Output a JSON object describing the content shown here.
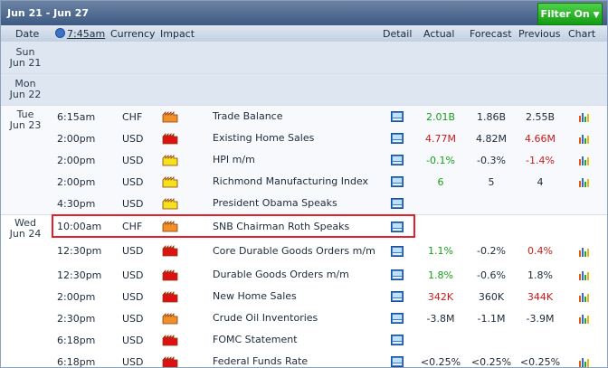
{
  "header": {
    "date_range": "Jun 21 - Jun 27",
    "filter_label": "Filter On"
  },
  "columns": {
    "date": "Date",
    "time": "7:45am",
    "currency": "Currency",
    "impact": "Impact",
    "detail": "Detail",
    "actual": "Actual",
    "forecast": "Forecast",
    "previous": "Previous",
    "chart": "Chart"
  },
  "days": {
    "sun": {
      "name": "Sun",
      "date": "Jun 21"
    },
    "mon": {
      "name": "Mon",
      "date": "Jun 22"
    },
    "tue": {
      "name": "Tue",
      "date": "Jun 23"
    },
    "wed": {
      "name": "Wed",
      "date": "Jun 24"
    }
  },
  "impact_colors": {
    "high": "#dd1111",
    "medium": "#f0902a",
    "low": "#f5e21a",
    "holiday": "#d94f1e"
  },
  "events": [
    {
      "time": "6:15am",
      "currency": "CHF",
      "impact": "medium",
      "event": "Trade Balance",
      "actual": "2.01B",
      "actual_color": "green",
      "forecast": "1.86B",
      "previous": "2.55B",
      "previous_color": "dark",
      "chart": true
    },
    {
      "time": "2:00pm",
      "currency": "USD",
      "impact": "high",
      "event": "Existing Home Sales",
      "actual": "4.77M",
      "actual_color": "red",
      "forecast": "4.82M",
      "previous": "4.66M",
      "previous_color": "red",
      "chart": true
    },
    {
      "time": "2:00pm",
      "currency": "USD",
      "impact": "low",
      "event": "HPI m/m",
      "actual": "-0.1%",
      "actual_color": "green",
      "forecast": "-0.3%",
      "previous": "-1.4%",
      "previous_color": "red",
      "chart": true
    },
    {
      "time": "2:00pm",
      "currency": "USD",
      "impact": "low",
      "event": "Richmond Manufacturing Index",
      "actual": "6",
      "actual_color": "green",
      "forecast": "5",
      "previous": "4",
      "previous_color": "dark",
      "chart": true
    },
    {
      "time": "4:30pm",
      "currency": "USD",
      "impact": "low",
      "event": "President Obama Speaks",
      "actual": "",
      "forecast": "",
      "previous": "",
      "chart": false
    },
    {
      "time": "10:00am",
      "currency": "CHF",
      "impact": "medium",
      "event": "SNB Chairman Roth Speaks",
      "actual": "",
      "forecast": "",
      "previous": "",
      "chart": false
    },
    {
      "time": "12:30pm",
      "currency": "USD",
      "impact": "high",
      "event": "Core Durable Goods Orders m/m",
      "actual": "1.1%",
      "actual_color": "green",
      "forecast": "-0.2%",
      "previous": "0.4%",
      "previous_color": "red",
      "chart": true
    },
    {
      "time": "12:30pm",
      "currency": "USD",
      "impact": "high",
      "event": "Durable Goods Orders m/m",
      "actual": "1.8%",
      "actual_color": "green",
      "forecast": "-0.6%",
      "previous": "1.8%",
      "previous_color": "dark",
      "chart": true
    },
    {
      "time": "2:00pm",
      "currency": "USD",
      "impact": "high",
      "event": "New Home Sales",
      "actual": "342K",
      "actual_color": "red",
      "forecast": "360K",
      "previous": "344K",
      "previous_color": "red",
      "chart": true
    },
    {
      "time": "2:30pm",
      "currency": "USD",
      "impact": "medium",
      "event": "Crude Oil Inventories",
      "actual": "-3.8M",
      "actual_color": "dark",
      "forecast": "-1.1M",
      "previous": "-3.9M",
      "previous_color": "dark",
      "chart": true
    },
    {
      "time": "6:18pm",
      "currency": "USD",
      "impact": "high",
      "event": "FOMC Statement",
      "actual": "",
      "forecast": "",
      "previous": "",
      "chart": false
    },
    {
      "time": "6:18pm",
      "currency": "USD",
      "impact": "high",
      "event": "Federal Funds Rate",
      "actual": "<0.25%",
      "actual_color": "dark",
      "forecast": "<0.25%",
      "previous": "<0.25%",
      "previous_color": "dark",
      "chart": true
    }
  ]
}
